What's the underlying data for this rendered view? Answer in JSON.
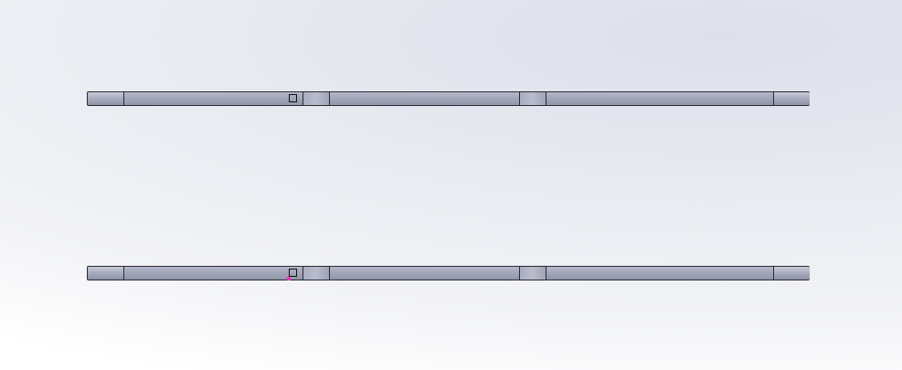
{
  "viewport": {
    "background_colors": [
      "#dde0ea",
      "#f2f3f6",
      "#ffffff"
    ]
  },
  "parts": [
    {
      "segments": [
        "end",
        "bar",
        "joint",
        "bar",
        "joint",
        "bar",
        "end"
      ],
      "has_marker": true,
      "has_origin_point": false
    },
    {
      "segments": [
        "end",
        "bar",
        "joint",
        "bar",
        "joint",
        "bar",
        "end"
      ],
      "has_marker": true,
      "has_origin_point": true
    }
  ],
  "colors": {
    "part_fill": "#a3a7ba",
    "edge": "#2a2b33",
    "origin_point": "#ff2bd0"
  }
}
